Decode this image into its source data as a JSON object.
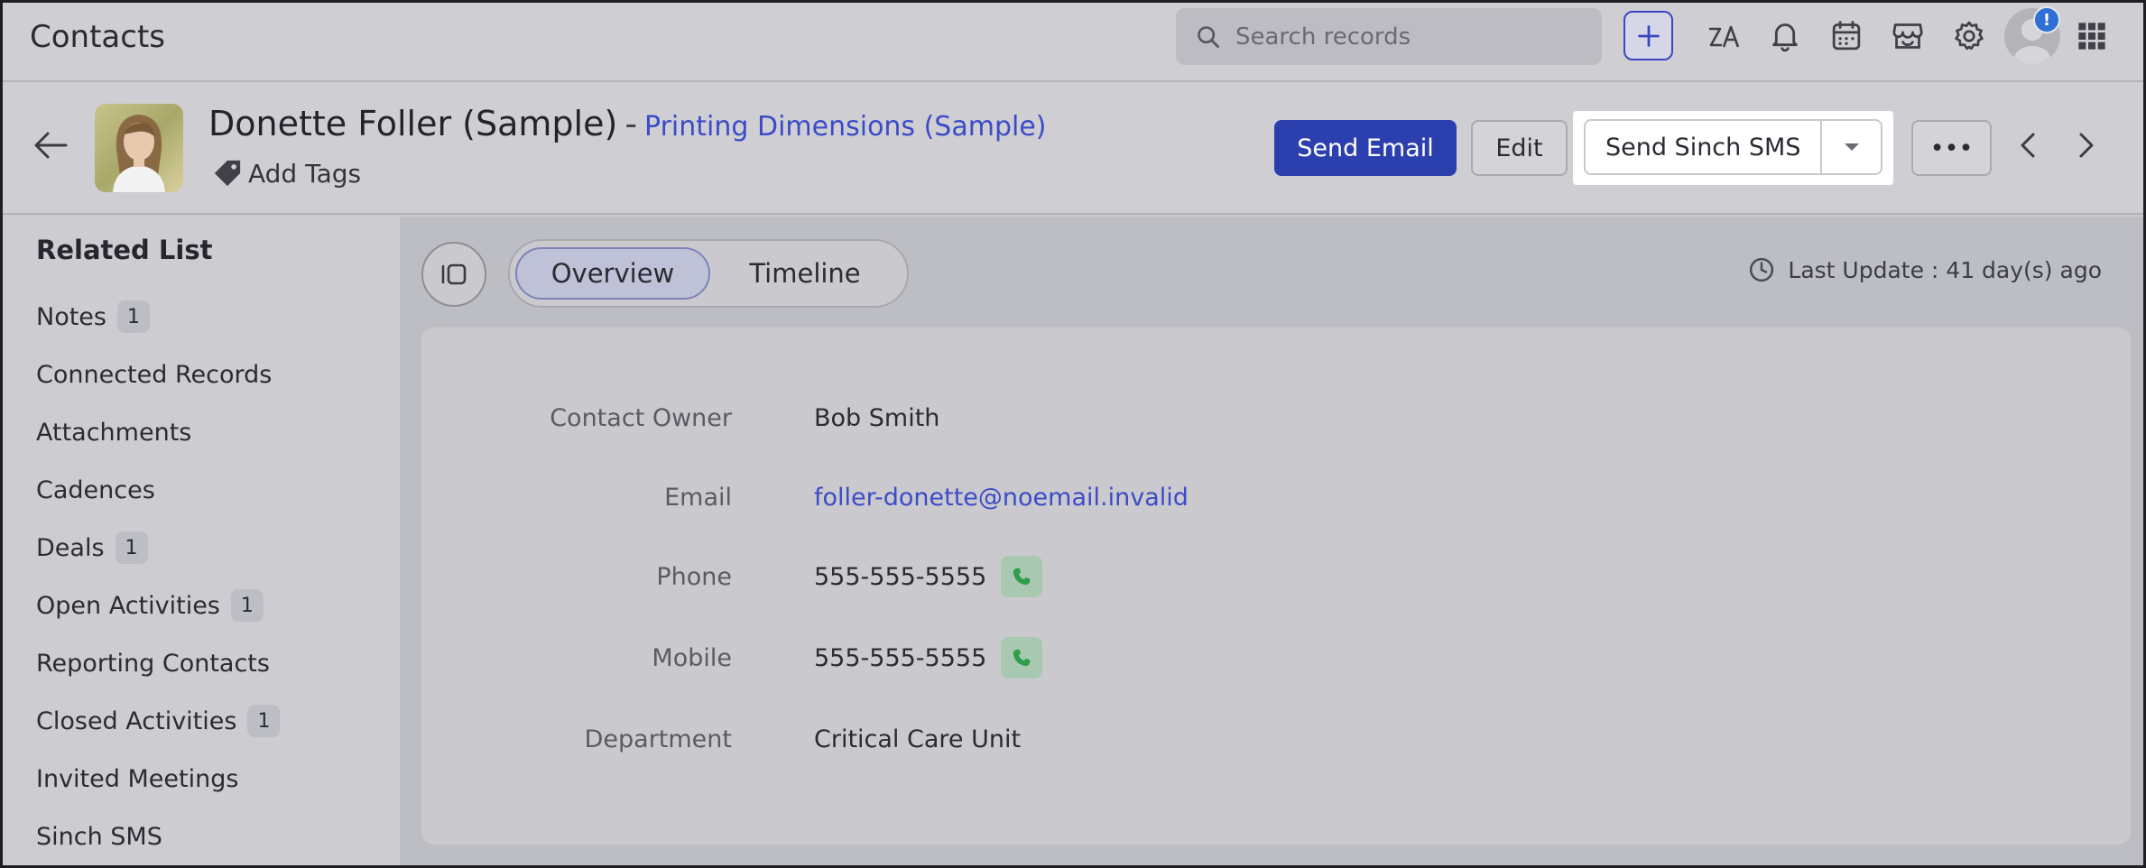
{
  "topbar": {
    "title": "Contacts",
    "search_placeholder": "Search records",
    "notification_badge": "!"
  },
  "record": {
    "name": "Donette Foller (Sample)",
    "separator": "-",
    "account": "Printing Dimensions (Sample)",
    "add_tags": "Add Tags"
  },
  "actions": {
    "send_email": "Send Email",
    "edit": "Edit",
    "send_sms": "Send Sinch SMS",
    "more": "•••"
  },
  "related": {
    "title": "Related List",
    "items": [
      {
        "label": "Notes",
        "count": "1"
      },
      {
        "label": "Connected Records",
        "count": ""
      },
      {
        "label": "Attachments",
        "count": ""
      },
      {
        "label": "Cadences",
        "count": ""
      },
      {
        "label": "Deals",
        "count": "1"
      },
      {
        "label": "Open Activities",
        "count": "1"
      },
      {
        "label": "Reporting Contacts",
        "count": ""
      },
      {
        "label": "Closed Activities",
        "count": "1"
      },
      {
        "label": "Invited Meetings",
        "count": ""
      },
      {
        "label": "Sinch SMS",
        "count": ""
      }
    ]
  },
  "tabs": {
    "overview": "Overview",
    "timeline": "Timeline",
    "active": "Overview"
  },
  "last_update": "Last Update : 41 day(s) ago",
  "details": {
    "contact_owner": {
      "label": "Contact Owner",
      "value": "Bob Smith"
    },
    "email": {
      "label": "Email",
      "value": "foller-donette@noemail.invalid"
    },
    "phone": {
      "label": "Phone",
      "value": "555-555-5555"
    },
    "mobile": {
      "label": "Mobile",
      "value": "555-555-5555"
    },
    "department": {
      "label": "Department",
      "value": "Critical Care Unit"
    }
  },
  "colors": {
    "primary": "#2c3fae",
    "link": "#3c4bc8",
    "phone_icon": "#2f9e4a",
    "badge": "#2f6fd6"
  },
  "icons": [
    "search-icon",
    "plus-icon",
    "translate-icon",
    "bell-icon",
    "calendar-icon",
    "store-icon",
    "gear-icon",
    "avatar",
    "apps-grid-icon",
    "back-arrow-icon",
    "tag-icon",
    "chevron-down-icon",
    "chevron-left-icon",
    "chevron-right-icon",
    "sidebar-toggle-icon",
    "clock-icon",
    "phone-icon"
  ]
}
